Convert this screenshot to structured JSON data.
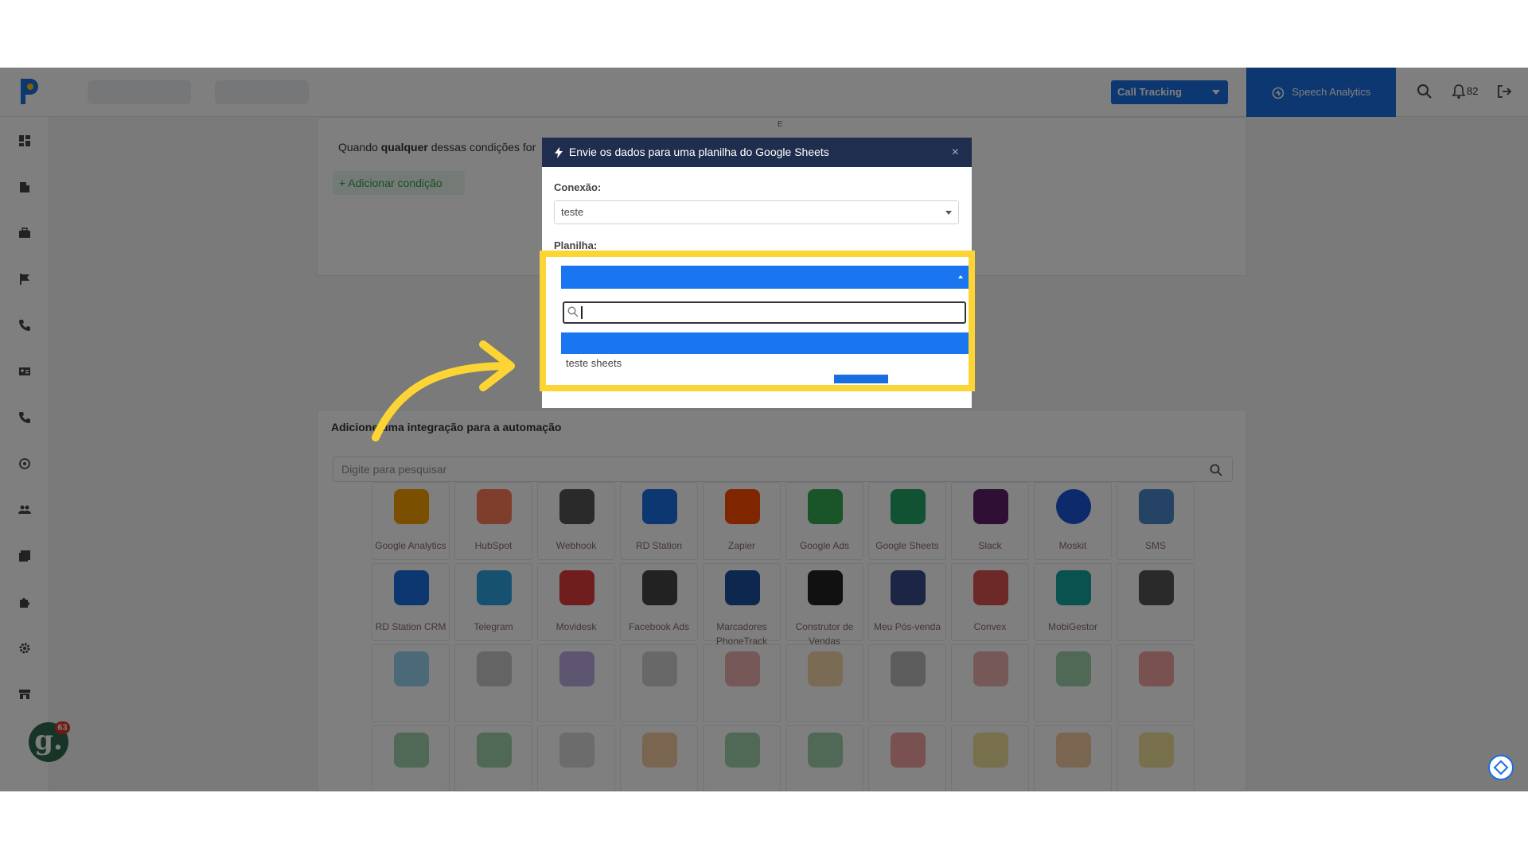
{
  "navbar": {
    "call_tracking_label": "Call Tracking",
    "speech_analytics_label": "Speech Analytics",
    "notification_count": "82"
  },
  "sidebar": {
    "badge_letter": "g.",
    "badge_count": "63"
  },
  "conditions": {
    "text_prefix": "Quando ",
    "text_bold": "qualquer",
    "text_suffix": " dessas condições for",
    "add_condition_label": "+ Adicionar condição",
    "connector_label": "E"
  },
  "integrations": {
    "title": "Adicione uma integração para a automação",
    "search_placeholder": "Digite para pesquisar",
    "row1": [
      "Google Analytics",
      "HubSpot",
      "Webhook",
      "RD Station",
      "Zapier",
      "Google Ads",
      "Google Sheets",
      "Slack",
      "Moskit",
      "SMS"
    ],
    "row2": [
      "RD Station CRM",
      "Telegram",
      "Movidesk",
      "Facebook Ads",
      "Marcadores PhoneTrack",
      "Construtor de Vendas",
      "Meu Pós-venda",
      "Convex",
      "MobiGestor",
      ""
    ]
  },
  "modal": {
    "title": "Envie os dados para uma planilha do Google Sheets",
    "close": "×",
    "connection_label": "Conexão:",
    "connection_value": "teste",
    "sheet_label": "Planilha:"
  },
  "dropdown": {
    "search_value": "",
    "option": "teste sheets"
  },
  "colors": {
    "accent": "#1a6fe0",
    "modal_header": "#1f2e4e",
    "highlight_border": "#fcd535",
    "success": "#2e9e4e"
  }
}
